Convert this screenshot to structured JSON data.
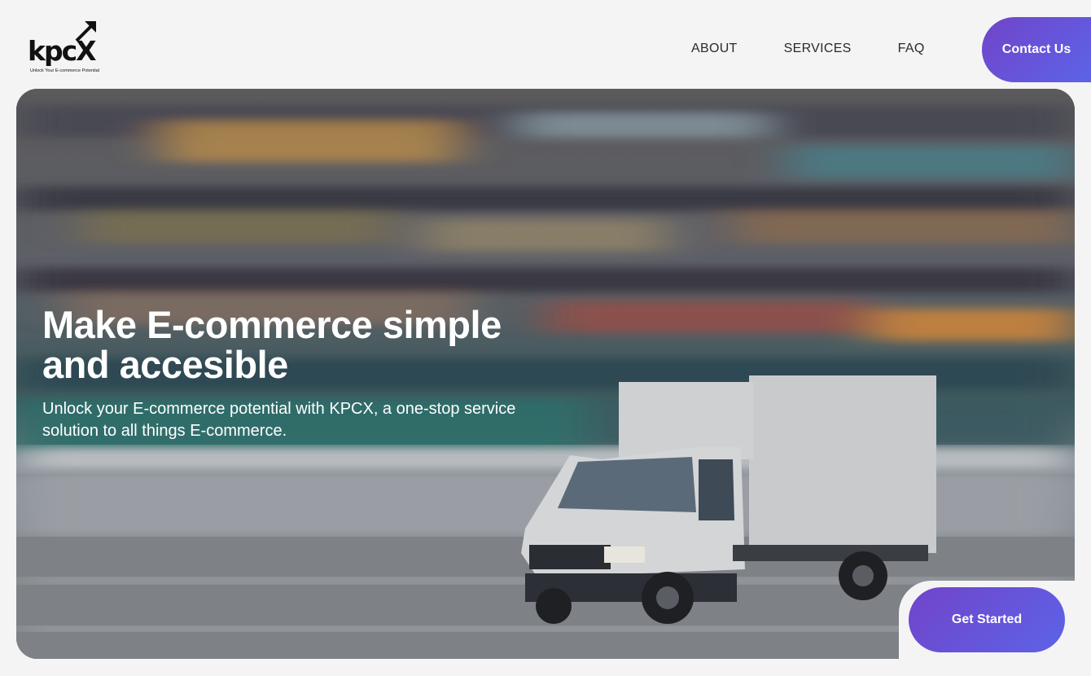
{
  "header": {
    "logo_text": "kpcX",
    "logo_tagline": "Unlock Your E-commerce Potential",
    "nav": [
      {
        "label": "ABOUT"
      },
      {
        "label": "SERVICES"
      },
      {
        "label": "FAQ"
      }
    ],
    "contact_label": "Contact Us"
  },
  "hero": {
    "title": "Make E-commerce simple and accesible",
    "subtitle": "Unlock your E-commerce potential with KPCX, a one-stop service solution to all things E-commerce.",
    "cta_label": "Get Started",
    "image": "motion-blurred-delivery-truck"
  },
  "colors": {
    "accent_start": "#7144c9",
    "accent_end": "#5c63e8",
    "page_bg": "#f4f4f4"
  }
}
